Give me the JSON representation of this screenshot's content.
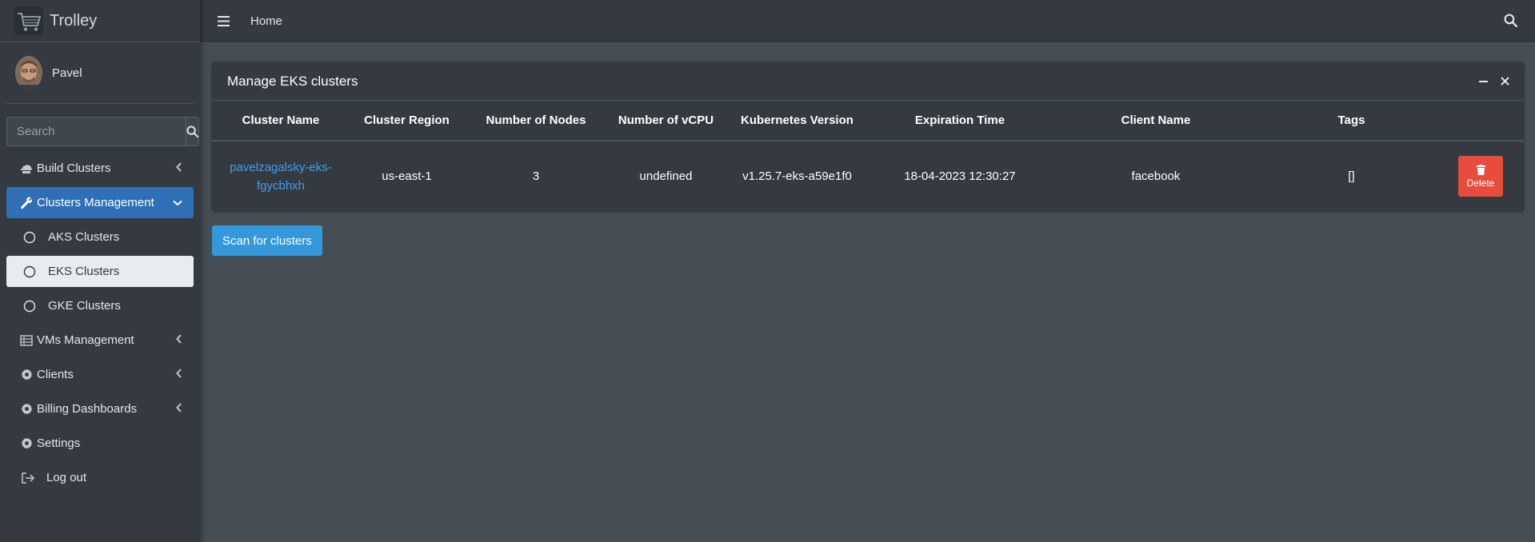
{
  "brand": {
    "name": "Trolley",
    "logo_icon": "cart-icon"
  },
  "user": {
    "name": "Pavel"
  },
  "search": {
    "placeholder": "Search"
  },
  "sidebar": {
    "items": [
      {
        "label": "Build Clusters",
        "icon": "cloud-server-icon",
        "chevron": "left"
      },
      {
        "label": "Clusters Management",
        "icon": "wrench-icon",
        "chevron": "down",
        "active": true
      },
      {
        "label": "AKS Clusters",
        "icon": "circle-icon",
        "sub": true
      },
      {
        "label": "EKS Clusters",
        "icon": "circle-icon",
        "sub": true,
        "selected": true
      },
      {
        "label": "GKE Clusters",
        "icon": "circle-icon",
        "sub": true
      },
      {
        "label": "VMs Management",
        "icon": "server-list-icon",
        "chevron": "left"
      },
      {
        "label": "Clients",
        "icon": "gear-icon",
        "chevron": "left"
      },
      {
        "label": "Billing Dashboards",
        "icon": "gear-icon",
        "chevron": "left"
      },
      {
        "label": "Settings",
        "icon": "gear-icon"
      },
      {
        "label": "Log out",
        "icon": "logout-icon"
      }
    ]
  },
  "topbar": {
    "home": "Home"
  },
  "card": {
    "title": "Manage EKS clusters",
    "columns": [
      "Cluster Name",
      "Cluster Region",
      "Number of Nodes",
      "Number of vCPU",
      "Kubernetes Version",
      "Expiration Time",
      "Client Name",
      "Tags",
      ""
    ],
    "rows": [
      {
        "cluster_name_line1": "pavelzagalsky-eks-",
        "cluster_name_line2": "fgycbhxh",
        "region": "us-east-1",
        "nodes": "3",
        "vcpu": "undefined",
        "k8s_version": "v1.25.7-eks-a59e1f0",
        "expiration": "18-04-2023 12:30:27",
        "client": "facebook",
        "tags": "[]",
        "delete_label": "Delete"
      }
    ]
  },
  "actions": {
    "scan_label": "Scan for clusters"
  },
  "colors": {
    "sidebar_bg": "#343a40",
    "content_bg": "#454d55",
    "active_nav": "#2f6fb5",
    "link": "#3f9cf0",
    "delete": "#e74c3c",
    "primary": "#3498db"
  }
}
